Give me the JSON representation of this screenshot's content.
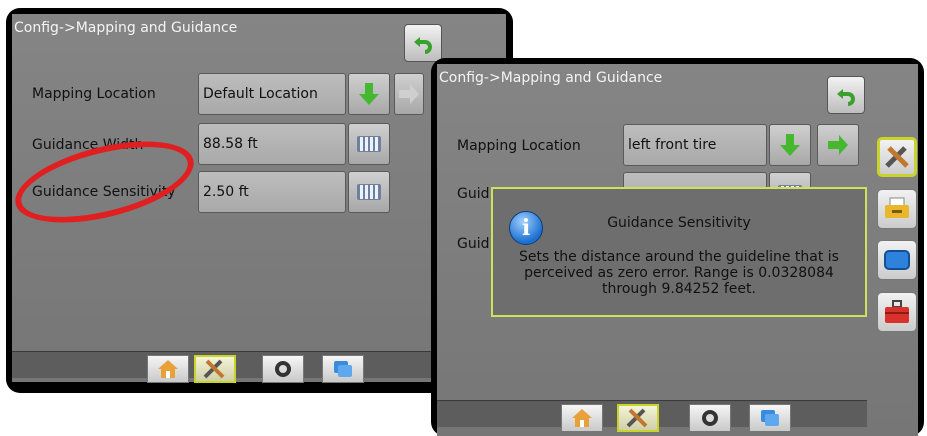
{
  "left_screen": {
    "title": "Config->Mapping and Guidance",
    "rows": [
      {
        "label": "Mapping Location",
        "value": "Default Location"
      },
      {
        "label": "Guidance Width",
        "value": "88.58 ft"
      },
      {
        "label": "Guidance Sensitivity",
        "value": "2.50 ft"
      }
    ]
  },
  "right_screen": {
    "title": "Config->Mapping and Guidance",
    "rows": [
      {
        "label": "Mapping Location",
        "value": "left front tire"
      },
      {
        "label": "Guid",
        "value": ""
      },
      {
        "label": "Guid",
        "value": ""
      }
    ],
    "popup": {
      "title": "Guidance Sensitivity",
      "body": "Sets the distance around the guideline that is perceived as zero error. Range is 0.0328084 through 9.84252 feet."
    }
  },
  "nav_icons": [
    "home-icon",
    "tools-icon",
    "gauge-icon",
    "layers-icon"
  ],
  "side_icons": [
    "tools-icon",
    "printer-icon",
    "display-icon",
    "toolbox-icon"
  ],
  "colors": {
    "highlight": "#c9d32a",
    "arrow_green": "#45b830",
    "annotation_red": "#e02020"
  }
}
